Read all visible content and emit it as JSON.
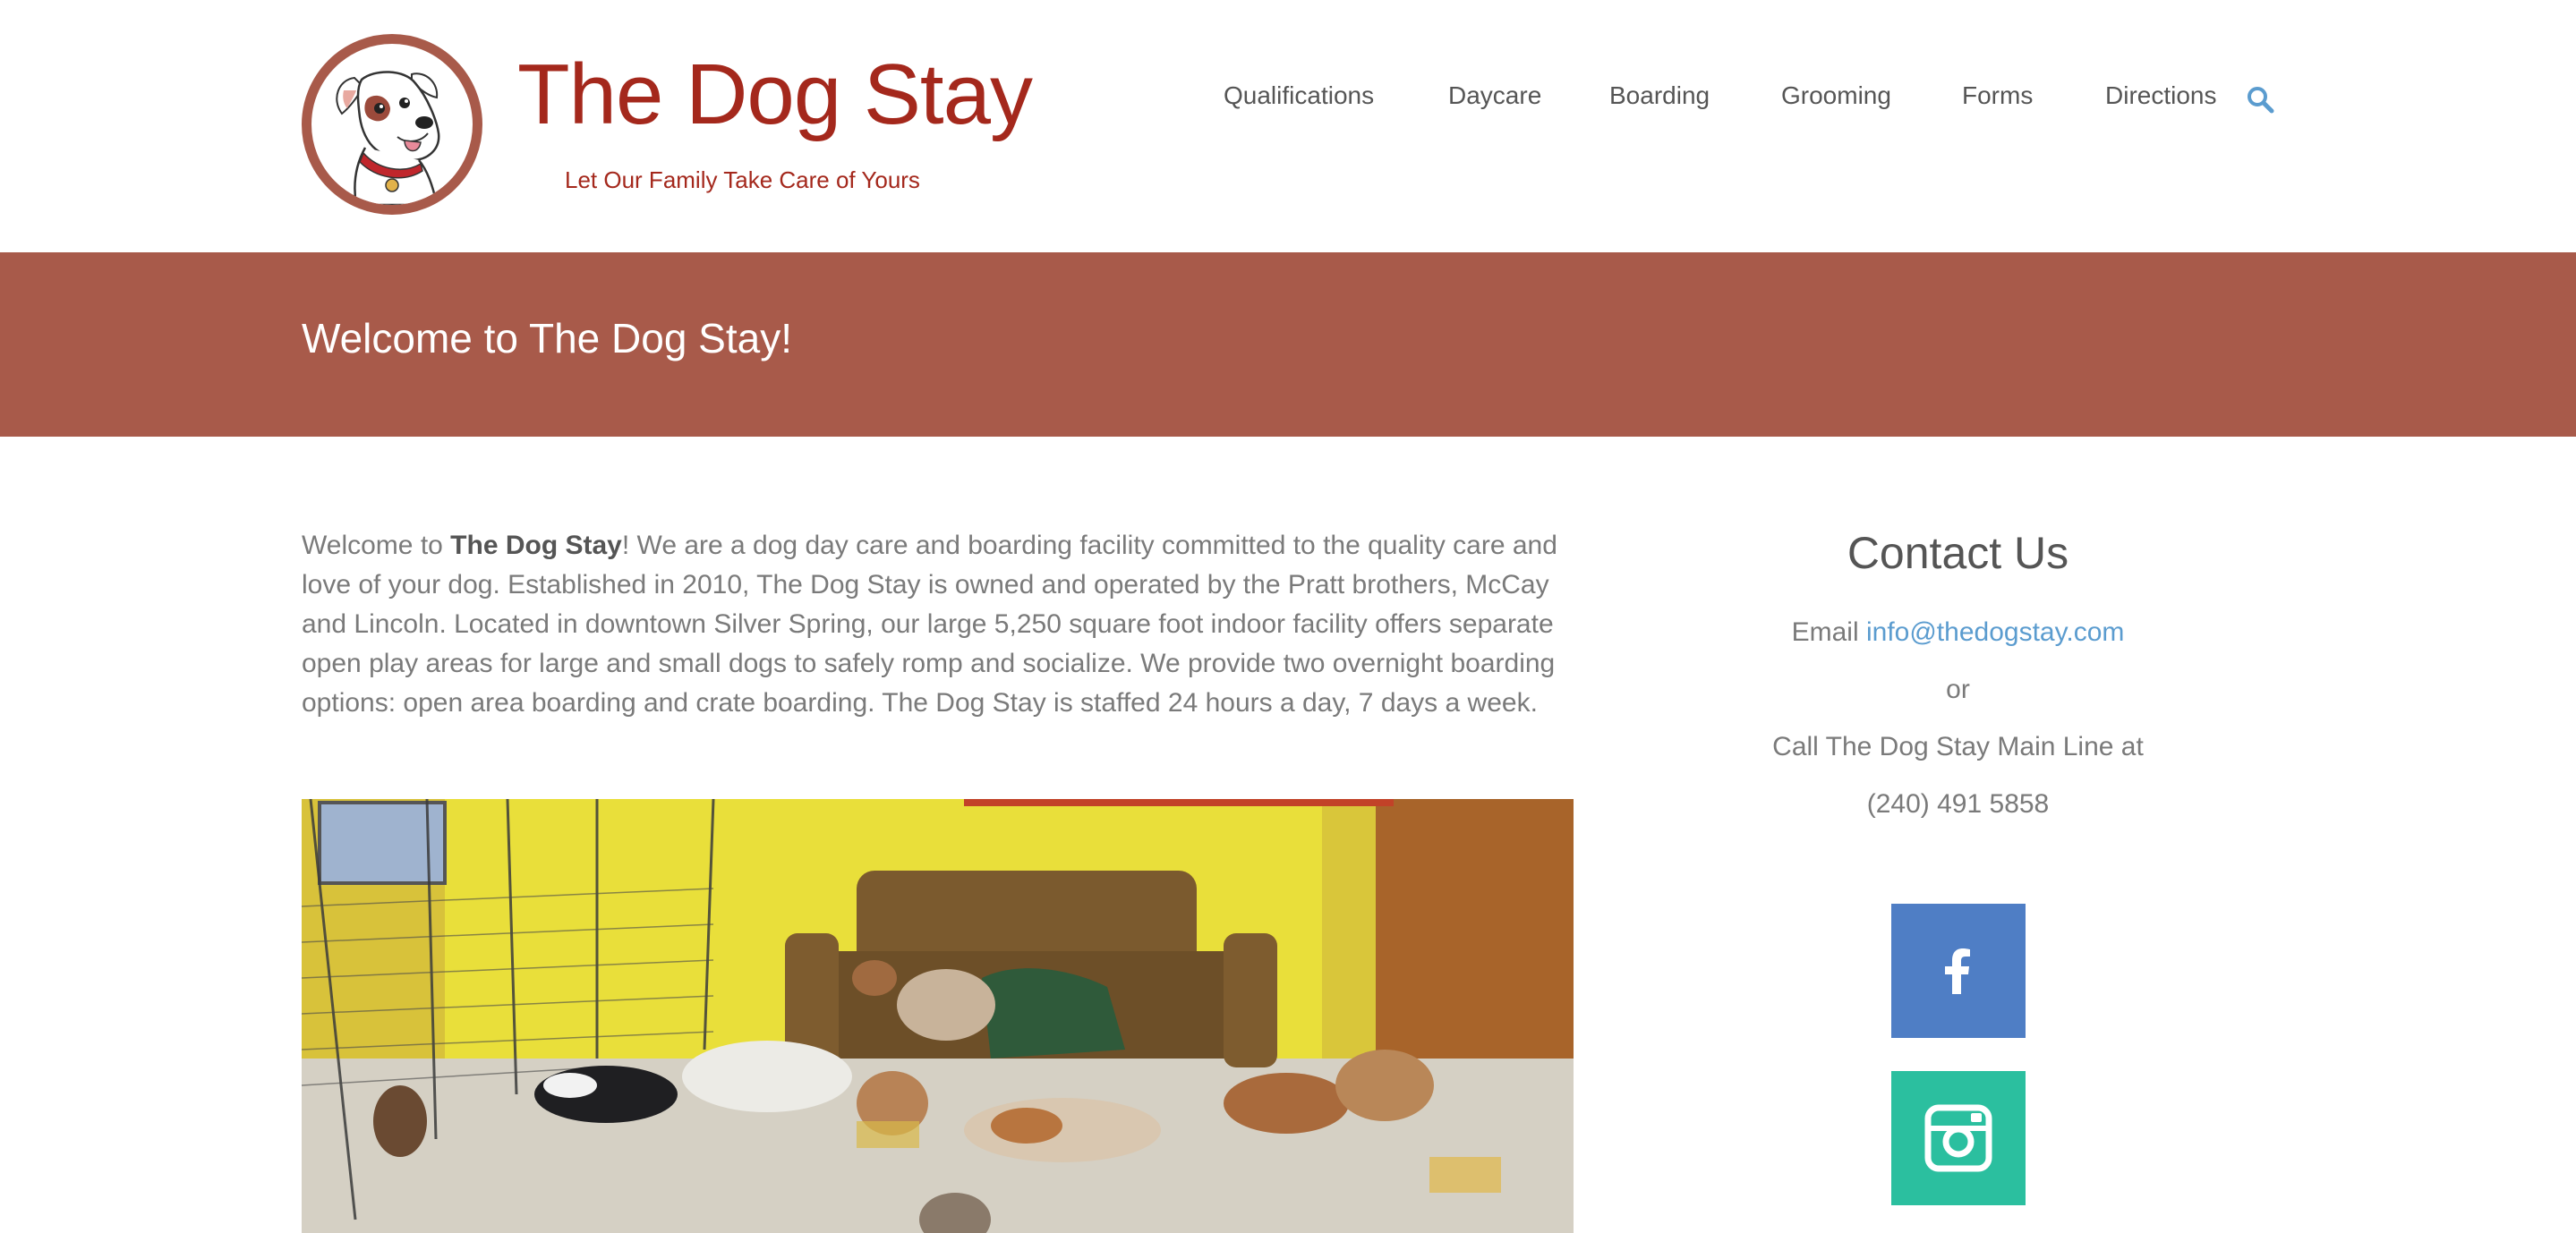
{
  "header": {
    "site_title": "The Dog Stay",
    "tagline": "Let Our Family Take Care of Yours",
    "nav": [
      {
        "label": "Qualifications"
      },
      {
        "label": "Daycare"
      },
      {
        "label": "Boarding"
      },
      {
        "label": "Grooming"
      },
      {
        "label": "Forms"
      },
      {
        "label": "Directions"
      }
    ],
    "search_icon": "search-icon"
  },
  "banner": {
    "title": "Welcome to The Dog Stay!"
  },
  "main": {
    "intro_prefix": "Welcome to ",
    "intro_bold": "The Dog Stay",
    "intro_rest": "! We are a dog day care and boarding facility committed to the quality care and love of your dog. Established in 2010, The Dog Stay is owned and operated by the Pratt brothers, McCay and Lincoln. Located in downtown Silver Spring, our large 5,250 square foot indoor facility offers separate open play areas for large and small dogs to safely romp and socialize. We provide two overnight boarding options: open area boarding and crate boarding. The Dog Stay is staffed 24 hours a day, 7 days a week."
  },
  "sidebar": {
    "contact_title": "Contact Us",
    "email_prefix": "Email ",
    "email": "info@thedogstay.com",
    "or": "or",
    "call_text": "Call The Dog Stay Main Line at",
    "phone": "(240) 491 5858",
    "social": [
      {
        "name": "facebook-icon"
      },
      {
        "name": "instagram-icon"
      }
    ]
  },
  "colors": {
    "brand_red": "#a4281c",
    "banner": "#a85a4a",
    "link": "#5b9ccf",
    "facebook": "#4f7ec5",
    "instagram": "#2bbf9f"
  }
}
